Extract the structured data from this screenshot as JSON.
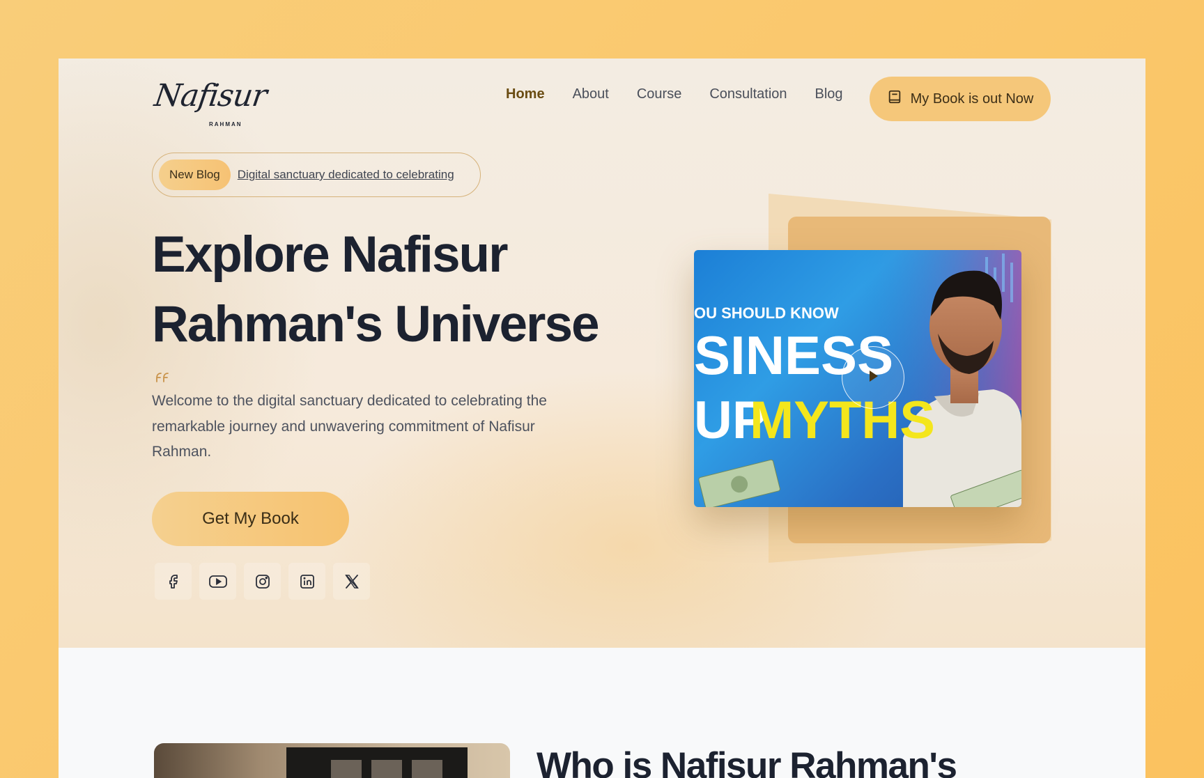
{
  "brand": {
    "logo_script": "Nafisur",
    "logo_sub": "RAHMAN"
  },
  "nav": {
    "items": [
      {
        "label": "Home",
        "active": true
      },
      {
        "label": "About",
        "active": false
      },
      {
        "label": "Course",
        "active": false
      },
      {
        "label": "Consultation",
        "active": false
      },
      {
        "label": "Blog",
        "active": false
      }
    ],
    "book_button": {
      "label": "My Book is out Now",
      "icon": "book-icon"
    }
  },
  "hero": {
    "badge": {
      "pill": "New Blog",
      "link": "Digital sanctuary dedicated to celebrating"
    },
    "headline_line1": "Explore Nafisur",
    "headline_line2": "Rahman's Universe",
    "quote_icon": "quote-icon",
    "lede": "Welcome to the digital sanctuary dedicated to celebrating the remarkable journey and unwavering commitment of Nafisur Rahman.",
    "cta_label": "Get My Book",
    "socials": [
      "facebook-icon",
      "youtube-icon",
      "instagram-icon",
      "linkedin-icon",
      "x-icon"
    ]
  },
  "video": {
    "thumb_line1": "OU SHOULD KNOW",
    "thumb_line2": "SINESS",
    "thumb_line3a": "UP",
    "thumb_line3b": "MYTHS",
    "play_icon": "play-icon"
  },
  "about": {
    "title": "Who is Nafisur Rahman's"
  },
  "colors": {
    "page_bg": "#fbc25f",
    "accent": "#f5c77a",
    "heading": "#1c2230",
    "active_nav": "#6a4c12",
    "thumb_yellow": "#f4e61c"
  }
}
